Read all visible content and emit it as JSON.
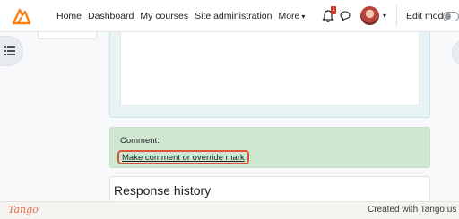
{
  "navbar": {
    "links": [
      "Home",
      "Dashboard",
      "My courses",
      "Site administration"
    ],
    "more_label": "More",
    "notification_count": "1",
    "edit_mode_label": "Edit mode"
  },
  "comment": {
    "label": "Comment:",
    "link": "Make comment or override mark"
  },
  "response_history": {
    "title": "Response history"
  },
  "footer": {
    "logo": "Tango",
    "credit": "Created with Tango.us"
  },
  "colors": {
    "comment_bg": "#cfe6d1",
    "highlight": "#e0553a",
    "logo_orange": "#f98012"
  }
}
